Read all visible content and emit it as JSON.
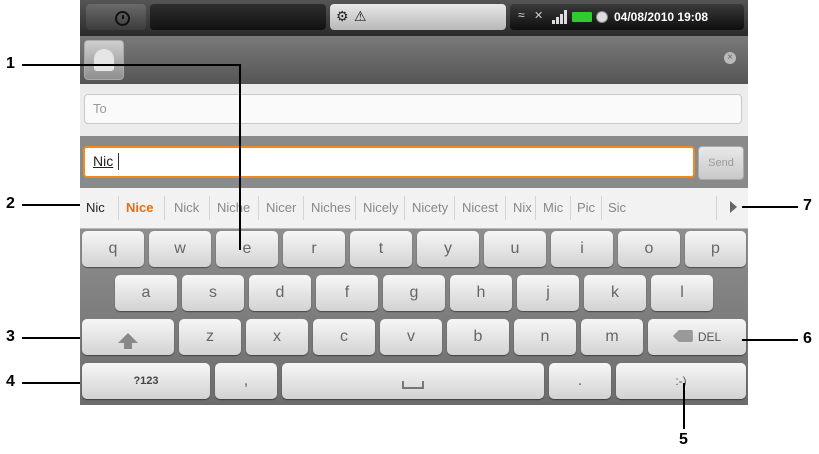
{
  "status_bar": {
    "datetime": "04/08/2010 19:08",
    "icons": [
      "clock-icon",
      "usb-icon",
      "warning-icon",
      "wifi-icon",
      "mute-icon",
      "signal-icon",
      "battery-icon",
      "sync-icon"
    ],
    "battery_color": "#2ecc2e"
  },
  "compose": {
    "to_placeholder": "To",
    "body_value": "Nic",
    "send_label": "Send",
    "focus_color": "#f08a1e"
  },
  "suggestions": [
    "Nic",
    "Nice",
    "Nick",
    "Niche",
    "Nicer",
    "Niches",
    "Nicely",
    "Nicety",
    "Nicest",
    "Nix",
    "Mic",
    "Pic",
    "Sic"
  ],
  "suggestion_highlight_color": "#e86d0c",
  "keyboard": {
    "row1": [
      "q",
      "w",
      "e",
      "r",
      "t",
      "y",
      "u",
      "i",
      "o",
      "p"
    ],
    "row2": [
      "a",
      "s",
      "d",
      "f",
      "g",
      "h",
      "j",
      "k",
      "l"
    ],
    "row3": [
      "z",
      "x",
      "c",
      "v",
      "b",
      "n",
      "m"
    ],
    "del_label": "DEL",
    "symbols_label": "?123",
    "comma": ",",
    "period": ".",
    "smiley": ":-)"
  },
  "callouts": [
    "1",
    "2",
    "3",
    "4",
    "5",
    "6",
    "7"
  ]
}
